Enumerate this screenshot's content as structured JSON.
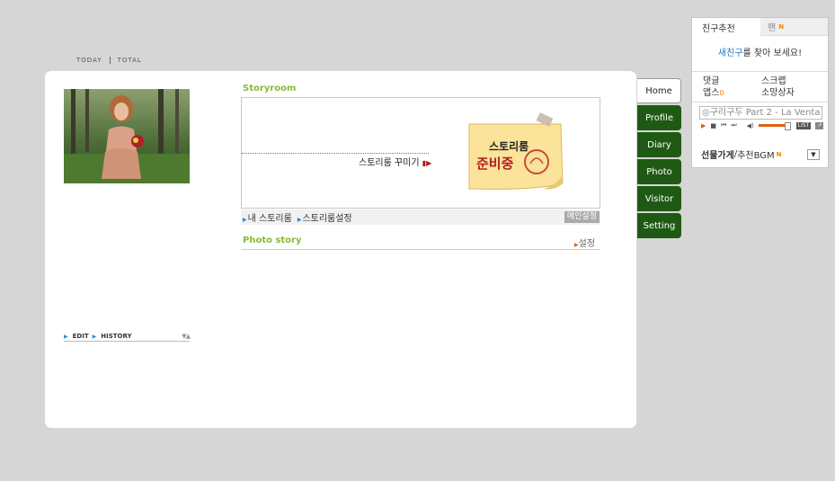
{
  "stats": {
    "today": "TODAY",
    "total": "TOTAL"
  },
  "profile": {
    "edit": "EDIT",
    "history": "HISTORY",
    "arrows": "▼▲"
  },
  "storyroom": {
    "title": "Storyroom",
    "decorate": "스토리룸 꾸미기",
    "decorate_arrow": "▮▶",
    "note_line1": "스토리룸",
    "note_line2": "준비중",
    "my_story": "내 스토리룸",
    "story_settings": "스토리룸설정",
    "main_settings": "메인설정"
  },
  "photostory": {
    "title": "Photo story",
    "settings": "설정"
  },
  "tabs": [
    {
      "label": "Home",
      "active": true
    },
    {
      "label": "Profile"
    },
    {
      "label": "Diary"
    },
    {
      "label": "Photo"
    },
    {
      "label": "Visitor"
    },
    {
      "label": "Setting"
    }
  ],
  "side": {
    "tab_friends": "친구추천",
    "tab_fan": "팬",
    "new_badge": "N",
    "find_blue": "새친구",
    "find_rest": "를 찾아 보세요!",
    "comments": "댓글",
    "scrap": "스크랩",
    "apps": "앱스",
    "apps_count": "0",
    "wishbox": "소망상자",
    "song": "구리구두 Part 2 - La Venta",
    "list_btn": "LIST",
    "gift": "선물가게",
    "gift_sep": " / ",
    "bgm": "추천BGM",
    "bgm_badge": "N"
  },
  "colors": {
    "tab_green": "#1f5a14",
    "title_green": "#8bb83a",
    "accent_orange": "#f08a00"
  }
}
